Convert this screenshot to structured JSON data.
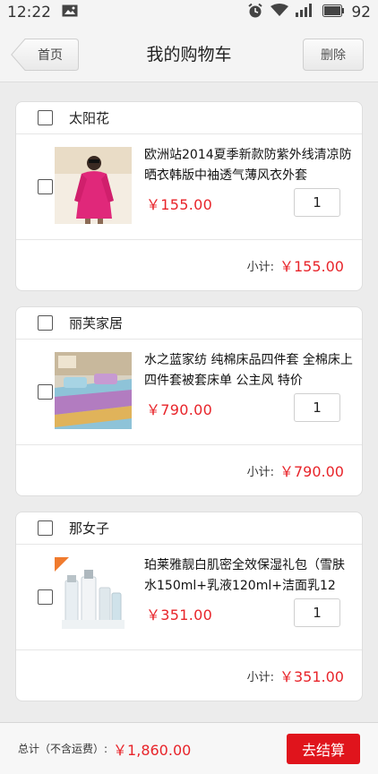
{
  "status_bar": {
    "time": "12:22",
    "battery": "92"
  },
  "nav": {
    "back_label": "首页",
    "title": "我的购物车",
    "delete_label": "删除"
  },
  "cart": [
    {
      "shop": "太阳花",
      "title": "欧洲站2014夏季新款防紫外线清凉防晒衣韩版中袖透气薄风衣外套",
      "price": "￥155.00",
      "quantity": "1",
      "subtotal_label": "小计:",
      "subtotal": "￥155.00",
      "thumb_icon": "product-photo-pink-coat"
    },
    {
      "shop": "丽芙家居",
      "title": "水之蓝家纺 纯棉床品四件套 全棉床上四件套被套床单 公主风 特价",
      "price": "￥790.00",
      "quantity": "1",
      "subtotal_label": "小计:",
      "subtotal": "￥790.00",
      "thumb_icon": "product-photo-bedding"
    },
    {
      "shop": "那女子",
      "title": "珀莱雅靓白肌密全效保湿礼包（雪肤水150ml+乳液120ml+洁面乳12",
      "price": "￥351.00",
      "quantity": "1",
      "subtotal_label": "小计:",
      "subtotal": "￥351.00",
      "thumb_icon": "product-photo-skincare"
    }
  ],
  "footer": {
    "total_label": "总计（不含运费）:",
    "total_value": "￥1,860.00",
    "checkout_label": "去结算"
  },
  "colors": {
    "price": "#e8242a",
    "checkout": "#e0141c"
  }
}
